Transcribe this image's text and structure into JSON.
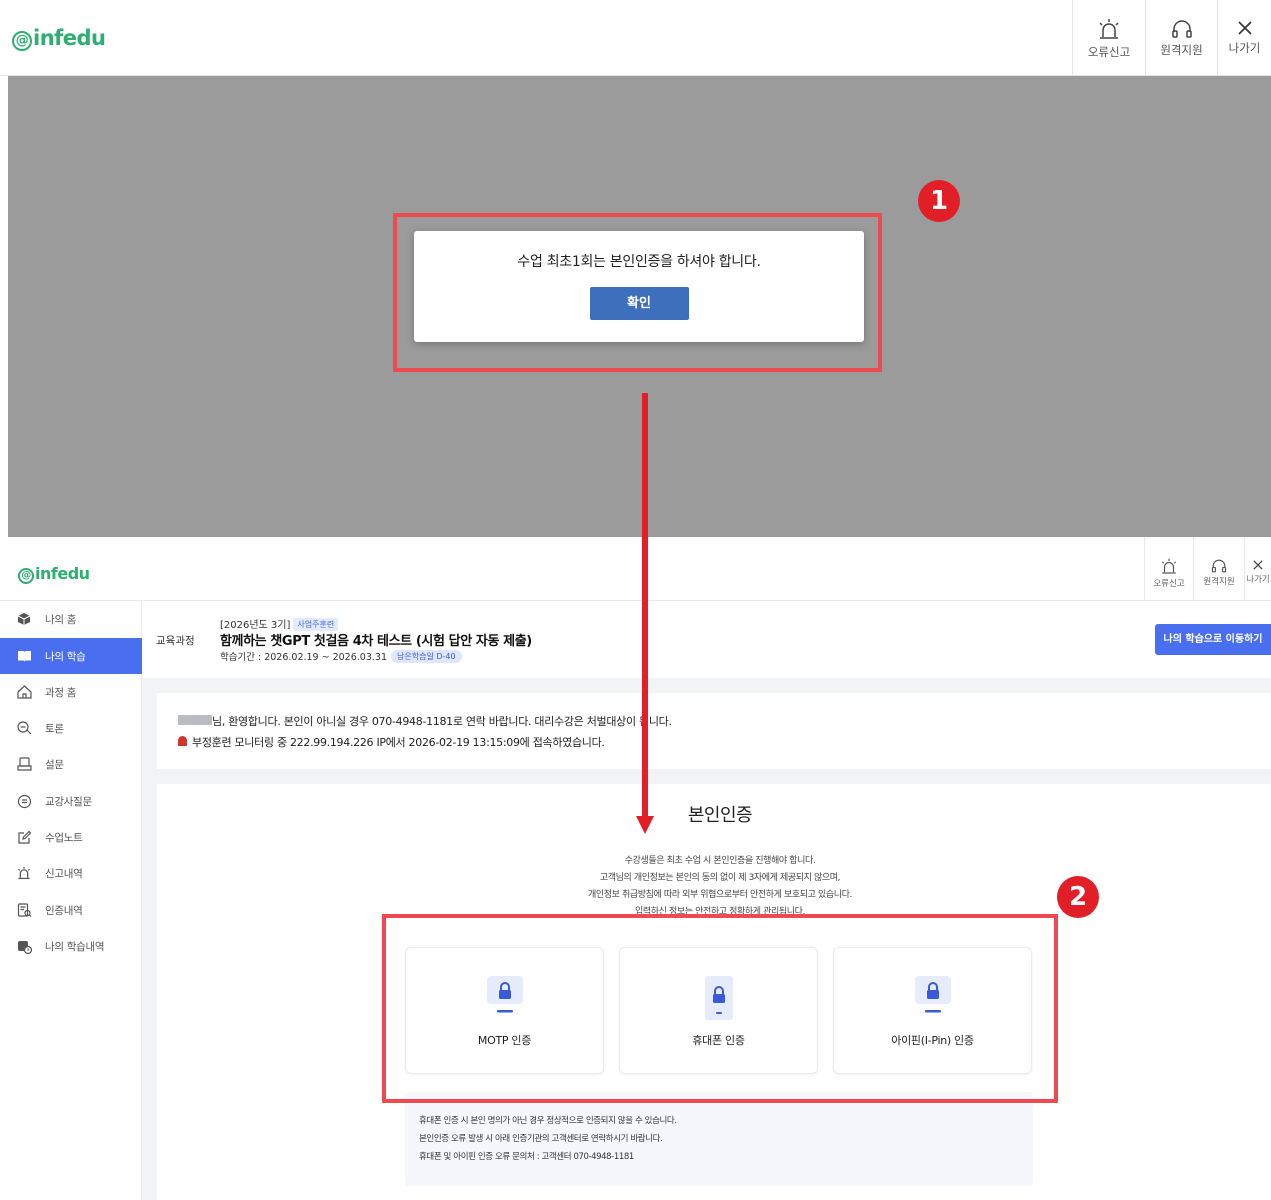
{
  "logo": {
    "mark": "@",
    "text": "infedu"
  },
  "header": {
    "report_label": "오류신고",
    "remote_label": "원격지원",
    "exit_label": "나가기"
  },
  "alert": {
    "message": "수업 최초1회는 본인인증을 하셔야 합니다.",
    "ok_label": "확인"
  },
  "annotations": {
    "badge_1": "1",
    "badge_2": "2"
  },
  "sub_header": {
    "report_label": "오류신고",
    "remote_label": "원격지원",
    "exit_label": "나가기"
  },
  "sidebar": {
    "items": [
      {
        "label": "나의 홈",
        "icon": "home-cube-icon"
      },
      {
        "label": "나의 학습",
        "icon": "book-icon",
        "active": true
      },
      {
        "label": "과정 홈",
        "icon": "house-icon"
      },
      {
        "label": "토론",
        "icon": "discussion-icon"
      },
      {
        "label": "설문",
        "icon": "survey-icon"
      },
      {
        "label": "교강사질문",
        "icon": "question-icon"
      },
      {
        "label": "수업노트",
        "icon": "note-edit-icon"
      },
      {
        "label": "신고내역",
        "icon": "siren-icon"
      },
      {
        "label": "인증내역",
        "icon": "certificate-icon"
      },
      {
        "label": "나의 학습내역",
        "icon": "history-icon"
      }
    ]
  },
  "course": {
    "label": "교육과정",
    "year": "[2026년도 3기]",
    "tag": "사업주훈련",
    "title": "함께하는 챗GPT 첫걸음 4차 테스트 (시험 답안 자동 제출)",
    "period": "학습기간 : 2026.02.19 ~ 2026.03.31",
    "remaining_label": "남은학습일",
    "remaining_value": "D-40",
    "move_button": "나의 학습으로 이동하기"
  },
  "notice": {
    "line1": "님, 환영합니다. 본인이 아니실 경우 070-4948-1181로 연락 바랍니다. 대리수강은 처벌대상이 됩니다.",
    "line2": "부정훈련 모니터링 중  222.99.194.226 IP에서 2026-02-19 13:15:09에 접속하였습니다."
  },
  "auth": {
    "title": "본인인증",
    "desc": [
      "수강생들은 최초 수업 시 본인인증을 진행해야 합니다.",
      "고객님의 개인정보는 본인의 동의 없이 제 3자에게 제공되지 않으며,",
      "개인정보 취급방침에 따라 외부 위협으로부터 안전하게 보호되고 있습니다.",
      "입력하신 정보는 안전하고 정확하게 관리됩니다."
    ],
    "methods": [
      {
        "label": "MOTP 인증",
        "icon": "lock-icon"
      },
      {
        "label": "휴대폰 인증",
        "icon": "phone-lock-icon"
      },
      {
        "label": "아이핀(I-Pin) 인증",
        "icon": "lock-icon"
      }
    ],
    "info": [
      "휴대폰 인증 시 본인 명의가 아닌 경우 정상적으로 인증되지 않을 수 있습니다.",
      "본인인증 오류 발생 시 아래 인증기관의 고객센터로 연락하시기 바랍니다.",
      "휴대폰 및 아이핀 인증 오류 문의처 : 고객센터 070-4948-1181"
    ]
  },
  "colors": {
    "brand_green": "#2dae72",
    "primary_blue": "#4a6ef0",
    "alert_button": "#3d6fbd",
    "annotation_red": "#e21f26"
  }
}
